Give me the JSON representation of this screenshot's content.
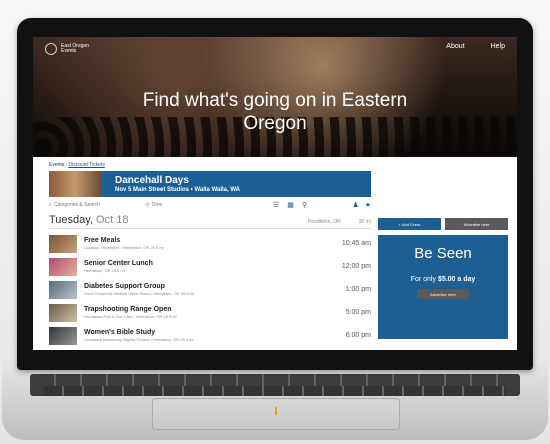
{
  "site": {
    "logo_line1": "East Oregon",
    "logo_line2": "Events"
  },
  "nav": [
    {
      "label": "About"
    },
    {
      "label": "Help"
    }
  ],
  "hero": {
    "title": "Find what's going on in Eastern Oregon"
  },
  "breadcrumb": {
    "prefix": "Events :",
    "link": "Discount Tickets"
  },
  "featured": {
    "title": "Dancehall Days",
    "subtitle": "Nov 5  Main Street Studios  •  Walla Walla, WA"
  },
  "toolbar": {
    "search_placeholder": "Categories & Search",
    "time_label": "Time"
  },
  "date_header": {
    "day": "Tuesday,",
    "date": "Oct 18",
    "location": "Pendleton, OR",
    "distance": "30 mi"
  },
  "events": [
    {
      "title": "Free Meals",
      "sub": "Location, Hermiston / Hermiston, OR   26.9 mi",
      "time": "10:45 am"
    },
    {
      "title": "Senior Center Lunch",
      "sub": "Hermiston, OR   26.9 mi",
      "time": "12:00 pm"
    },
    {
      "title": "Diabetes Support Group",
      "sub": "Good Shepherd Medical Office Plaza / Hermiston, OR   26.9 mi",
      "time": "1:00 pm"
    },
    {
      "title": "Trapshooting Range Open",
      "sub": "Hermiston Rod & Gun Club / Hermiston, OR   26.9 mi",
      "time": "5:00 pm"
    },
    {
      "title": "Women's Bible Study",
      "sub": "Landmark Missionary Baptist Church / Hermiston, OR   26.9 mi",
      "time": "6:00 pm"
    }
  ],
  "sidebar": {
    "add_event": "+ Add Event",
    "advertise": "Advertise here",
    "promo_title": "Be Seen",
    "promo_prefix": "For only",
    "promo_price": "$5.00 a day",
    "promo_button": "Advertise here"
  },
  "colors": {
    "accent": "#1e5f93",
    "button_dark": "#5a5a5a"
  }
}
